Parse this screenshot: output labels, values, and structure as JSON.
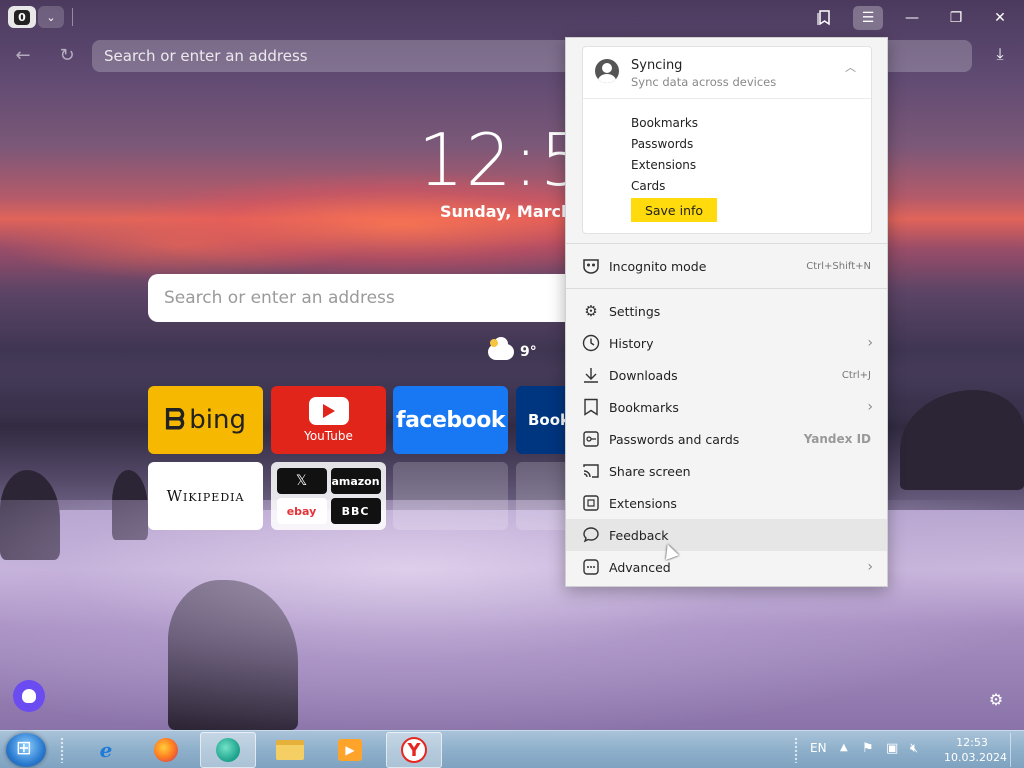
{
  "tabs": {
    "count": "0",
    "dropdown_icon": "chevron-down-icon"
  },
  "window": {
    "collections_icon": "collections-icon",
    "menu_icon": "hamburger-icon"
  },
  "address_bar": {
    "placeholder": "Search or enter an address"
  },
  "newtab": {
    "clock": "12:5",
    "date": "Sunday, March",
    "search_placeholder": "Search or enter an address",
    "weather_temp": "9°"
  },
  "speed_dial": {
    "bing": "bing",
    "youtube": "YouTube",
    "facebook": "facebook",
    "booking": "Booki",
    "wikipedia": "Wikipedia",
    "folder": {
      "x": "𝕏",
      "amazon": "amazon",
      "ebay": "ebay",
      "bbc": "BBC"
    }
  },
  "menu": {
    "sync": {
      "title": "Syncing",
      "subtitle": "Sync data across devices",
      "items": [
        "Bookmarks",
        "Passwords",
        "Extensions",
        "Cards"
      ],
      "save_button": "Save info"
    },
    "incognito": {
      "label": "Incognito mode",
      "shortcut": "Ctrl+Shift+N"
    },
    "items": [
      {
        "label": "Settings"
      },
      {
        "label": "History"
      },
      {
        "label": "Downloads",
        "shortcut": "Ctrl+J"
      },
      {
        "label": "Bookmarks"
      },
      {
        "label": "Passwords and cards",
        "badge": "Yandex ID"
      },
      {
        "label": "Share screen"
      },
      {
        "label": "Extensions"
      },
      {
        "label": "Feedback"
      },
      {
        "label": "Advanced"
      }
    ]
  },
  "taskbar": {
    "language": "EN",
    "time": "12:53",
    "date": "10.03.2024"
  },
  "colors": {
    "yandex_yellow": "#ffdb0d",
    "facebook_blue": "#1877f2",
    "youtube_red": "#e1251b",
    "bing_yellow": "#f6b800"
  }
}
